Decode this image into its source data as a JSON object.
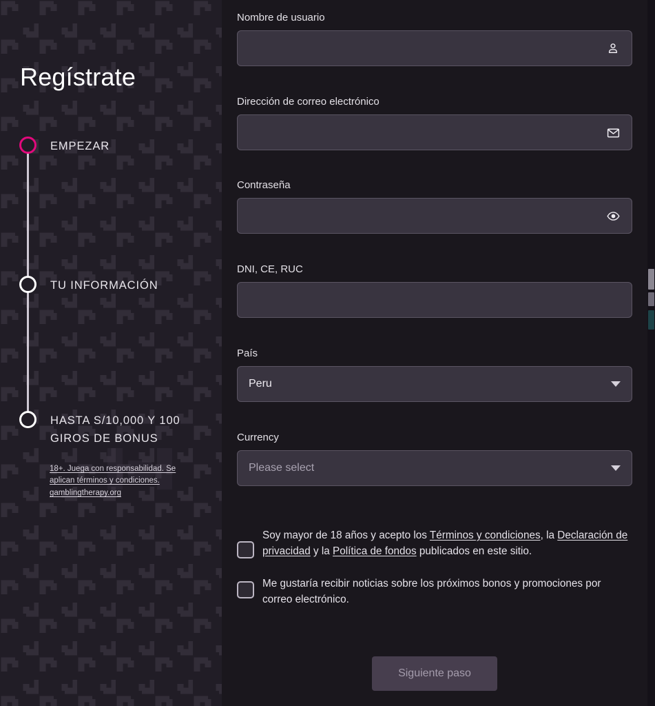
{
  "sidebar": {
    "title": "Regístrate",
    "steps": [
      {
        "label": "EMPEZAR",
        "state": "active",
        "dot": "step-dot-active"
      },
      {
        "label": "TU INFORMACIÓN",
        "state": "inactive",
        "dot": "step-dot-inactive"
      },
      {
        "label": "HASTA S/10,000 Y 100 GIROS DE BONUS",
        "state": "inactive",
        "dot": "step-dot-inactive"
      }
    ],
    "disclaimer": "18+. Juega con responsabilidad. Se aplican términos y condiciones. gamblingtherapy.org",
    "accent_color": "#e2097c",
    "background_color": "#211d26"
  },
  "form": {
    "fields": [
      {
        "label": "Nombre de usuario",
        "value": "",
        "placeholder": "",
        "icon": "user-icon",
        "type": "text"
      },
      {
        "label": "Dirección de correo electrónico",
        "value": "",
        "placeholder": "",
        "icon": "envelope-icon",
        "type": "email"
      },
      {
        "label": "Contraseña",
        "value": "",
        "placeholder": "",
        "icon": "eye-icon",
        "type": "password"
      },
      {
        "label": "DNI, CE, RUC",
        "value": "",
        "placeholder": "",
        "icon": "",
        "type": "text"
      }
    ],
    "selects": [
      {
        "label": "País",
        "value": "Peru",
        "is_placeholder": false,
        "icon": "chevron-down-icon"
      },
      {
        "label": "Currency",
        "value": "Please select",
        "is_placeholder": true,
        "icon": "chevron-down-icon"
      }
    ],
    "checkboxes": [
      {
        "checked": false,
        "parts": [
          {
            "text": "Soy mayor de 18 años y acepto los ",
            "link": false
          },
          {
            "text": "Términos y condiciones",
            "link": true
          },
          {
            "text": ", la ",
            "link": false
          },
          {
            "text": "Declaración de privacidad",
            "link": true
          },
          {
            "text": " y la ",
            "link": false
          },
          {
            "text": "Política de fondos",
            "link": true
          },
          {
            "text": " publicados en este sitio.",
            "link": false
          }
        ]
      },
      {
        "checked": false,
        "parts": [
          {
            "text": "Me gustaría recibir noticias sobre los próximos bonos y promociones por correo electrónico.",
            "link": false
          }
        ]
      }
    ],
    "submit_label": "Siguiente paso",
    "submit_enabled": false
  },
  "colors": {
    "page_background": "#1a171d",
    "input_background": "#393440",
    "input_border": "#5b5563",
    "text_primary": "#e5e2e9",
    "button_background": "#473e4e",
    "button_text": "#a49cac"
  }
}
